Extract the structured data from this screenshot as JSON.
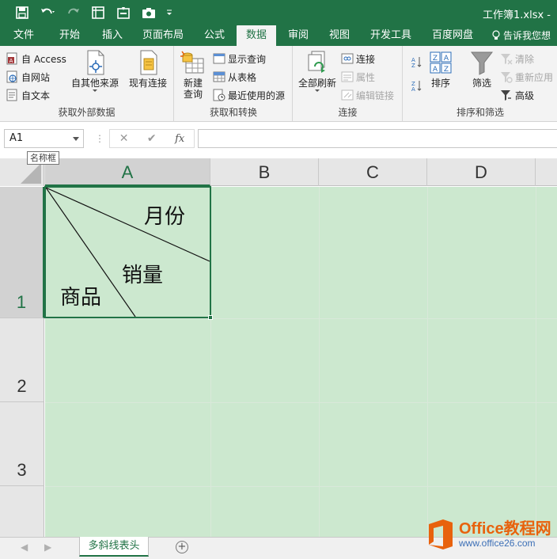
{
  "titlebar": {
    "doc_title": "工作簿1.xlsx -"
  },
  "tabs": [
    {
      "label": "文件"
    },
    {
      "label": "开始"
    },
    {
      "label": "插入"
    },
    {
      "label": "页面布局"
    },
    {
      "label": "公式"
    },
    {
      "label": "数据"
    },
    {
      "label": "审阅"
    },
    {
      "label": "视图"
    },
    {
      "label": "开发工具"
    },
    {
      "label": "百度网盘"
    }
  ],
  "active_tab": "数据",
  "tell_me": "告诉我您想",
  "ribbon": {
    "external": {
      "label": "获取外部数据",
      "access": "自 Access",
      "web": "自网站",
      "text": "自文本",
      "other": "自其他来源",
      "existing": "现有连接"
    },
    "transform": {
      "label": "获取和转换",
      "new_query_1": "新建",
      "new_query_2": "查询",
      "show_query": "显示查询",
      "from_table": "从表格",
      "recent": "最近使用的源"
    },
    "connections": {
      "label": "连接",
      "refresh_all": "全部刷新",
      "connections": "连接",
      "properties": "属性",
      "edit_links": "编辑链接"
    },
    "sort_filter": {
      "label": "排序和筛选",
      "sort": "排序",
      "filter": "筛选",
      "clear": "清除",
      "reapply": "重新应用",
      "advanced": "高级"
    }
  },
  "formula_bar": {
    "name_box": "A1",
    "cancel": "✕",
    "enter": "✔",
    "fx": "fx",
    "tooltip": "名称框"
  },
  "columns": [
    "A",
    "B",
    "C",
    "D"
  ],
  "rows": [
    "1",
    "2",
    "3"
  ],
  "cell_a1": {
    "month": "月份",
    "sales": "销量",
    "product": "商品"
  },
  "sheet_tabs": [
    {
      "label": "多斜线表头"
    }
  ],
  "watermark": {
    "brand": "Office教程网",
    "url": "www.office26.com"
  },
  "colors": {
    "excel_green": "#217346",
    "selection_fill": "#cce8cf",
    "watermark_orange": "#e8620d"
  }
}
